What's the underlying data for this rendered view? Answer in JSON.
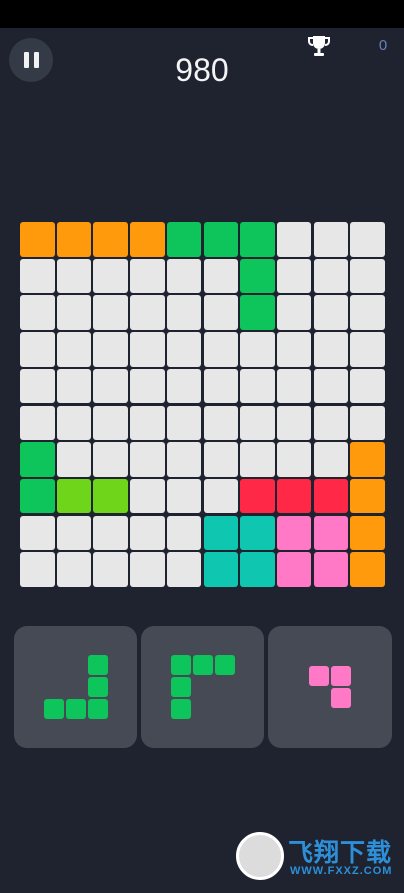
{
  "hud": {
    "score": "980",
    "best_score": "0"
  },
  "icons": {
    "pause": "pause-icon",
    "trophy": "trophy-icon"
  },
  "colors": {
    "background": "#1f2330",
    "empty_cell": "#e7e7e7",
    "tray": "#464a55",
    "best_score_text": "#6c7fbf",
    "O": "#ff9a0c",
    "G": "#0ec55c",
    "L": "#6fd51b",
    "R": "#ff2947",
    "T": "#0fc6b1",
    "P": "#ff79c6"
  },
  "board": {
    "rows": 10,
    "cols": 10,
    "grid": [
      "OOOOGGG...",
      "......G...",
      "......G...",
      "..........",
      "..........",
      "..........",
      "G........O",
      "GLL...RRRO",
      ".....TTPPO",
      ".....TTPPO"
    ]
  },
  "pieces": [
    {
      "color": "G",
      "cells": [
        [
          0,
          2
        ],
        [
          1,
          2
        ],
        [
          2,
          0
        ],
        [
          2,
          1
        ],
        [
          2,
          2
        ]
      ]
    },
    {
      "color": "G",
      "cells": [
        [
          0,
          0
        ],
        [
          0,
          1
        ],
        [
          0,
          2
        ],
        [
          1,
          0
        ],
        [
          2,
          0
        ]
      ]
    },
    {
      "color": "P",
      "cells": [
        [
          0,
          0
        ],
        [
          0,
          1
        ],
        [
          1,
          1
        ]
      ]
    }
  ],
  "watermark": {
    "name": "飞翔下载",
    "url": "WWW.FXXZ.COM"
  }
}
